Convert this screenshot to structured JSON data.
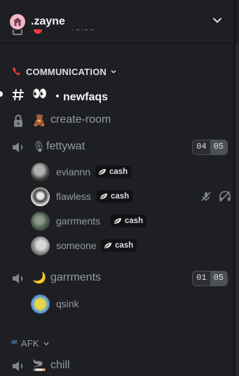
{
  "server": {
    "name": ".zayne",
    "icon": "house-icon"
  },
  "partial_row": {
    "text": "rules"
  },
  "categories": [
    {
      "label": "COMMUNICATION",
      "icon": "telephone-icon"
    },
    {
      "label": "AFK",
      "icon": "zzz-icon"
    }
  ],
  "channels": {
    "newfaqs": {
      "emoji": "👀",
      "name": "・newfaqs",
      "type": "text"
    },
    "create_room": {
      "emoji": "🧸",
      "name": "create-room",
      "type": "locked-voice"
    },
    "fettywat": {
      "emoji": "🎙",
      "name": "fettywat",
      "type": "voice",
      "count": "04",
      "limit": "05"
    },
    "garrments": {
      "emoji": "🌙",
      "name": "garrments",
      "type": "voice",
      "count": "01",
      "limit": "05"
    },
    "chill": {
      "emoji": "🚬",
      "name": "chill",
      "type": "voice"
    }
  },
  "voice_users": {
    "fettywat": [
      {
        "name": "eviannn",
        "tag": "cash",
        "muted": false
      },
      {
        "name": "flawless",
        "tag": "cash",
        "muted": true,
        "deafened": true
      },
      {
        "name": "garrments",
        "tag": "cash",
        "muted": false
      },
      {
        "name": "someone",
        "tag": "cash",
        "muted": false
      }
    ],
    "garrments": [
      {
        "name": "qsink"
      }
    ]
  },
  "colors": {
    "background": "#1e1f22",
    "text_muted": "#949ba4",
    "text_active": "#f2f3f5",
    "danger": "#f23f43"
  }
}
